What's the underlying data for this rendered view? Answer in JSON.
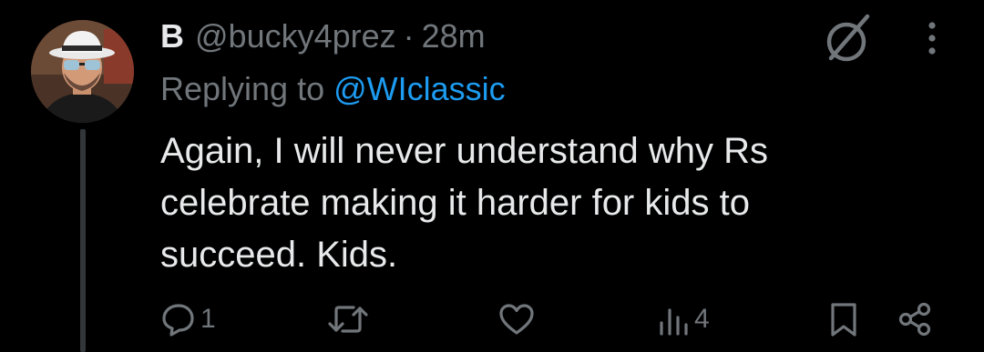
{
  "tweet": {
    "author_name": "B",
    "author_handle": "@bucky4prez",
    "separator": "·",
    "timestamp": "28m",
    "replying_prefix": "Replying to",
    "replying_to": "@WIclassic",
    "text": "Again, I will never understand why Rs\ncelebrate making it harder for kids to\nsucceed. Kids."
  },
  "actions": {
    "reply_count": "1",
    "retweet_count": "",
    "like_count": "",
    "views_count": "4"
  },
  "icons": {
    "grok": "grok-icon",
    "more": "more-vertical-icon",
    "reply": "reply-icon",
    "retweet": "retweet-icon",
    "like": "heart-icon",
    "views": "views-icon",
    "bookmark": "bookmark-icon",
    "share": "share-icon"
  },
  "colors": {
    "background": "#000000",
    "text": "#e7e9ea",
    "muted": "#71767b",
    "link": "#1d9bf0",
    "thread_line": "#333639"
  }
}
